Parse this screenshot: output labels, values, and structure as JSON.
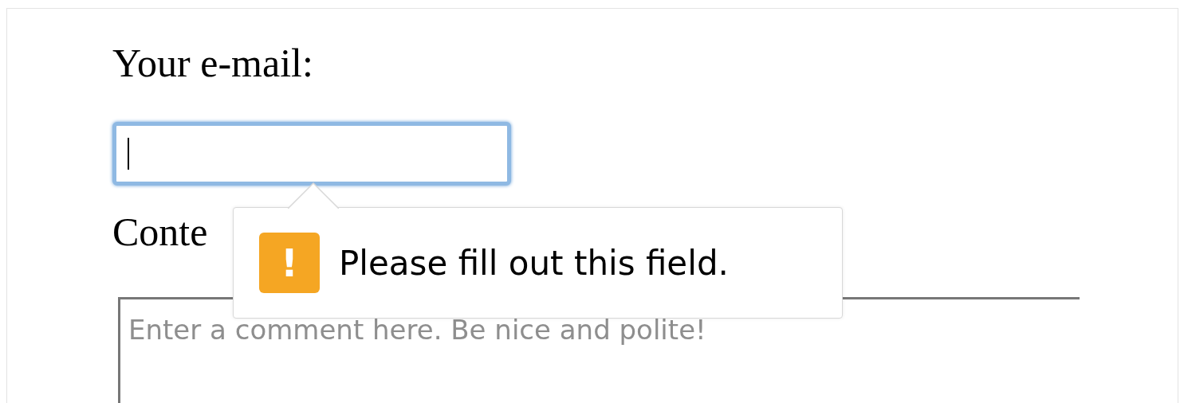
{
  "email": {
    "label": "Your e-mail:",
    "focused": true
  },
  "content": {
    "label": "Conte",
    "placeholder": "Enter a comment here. Be nice and polite!"
  },
  "tooltip": {
    "icon": "!",
    "message": "Please fill out this field."
  }
}
